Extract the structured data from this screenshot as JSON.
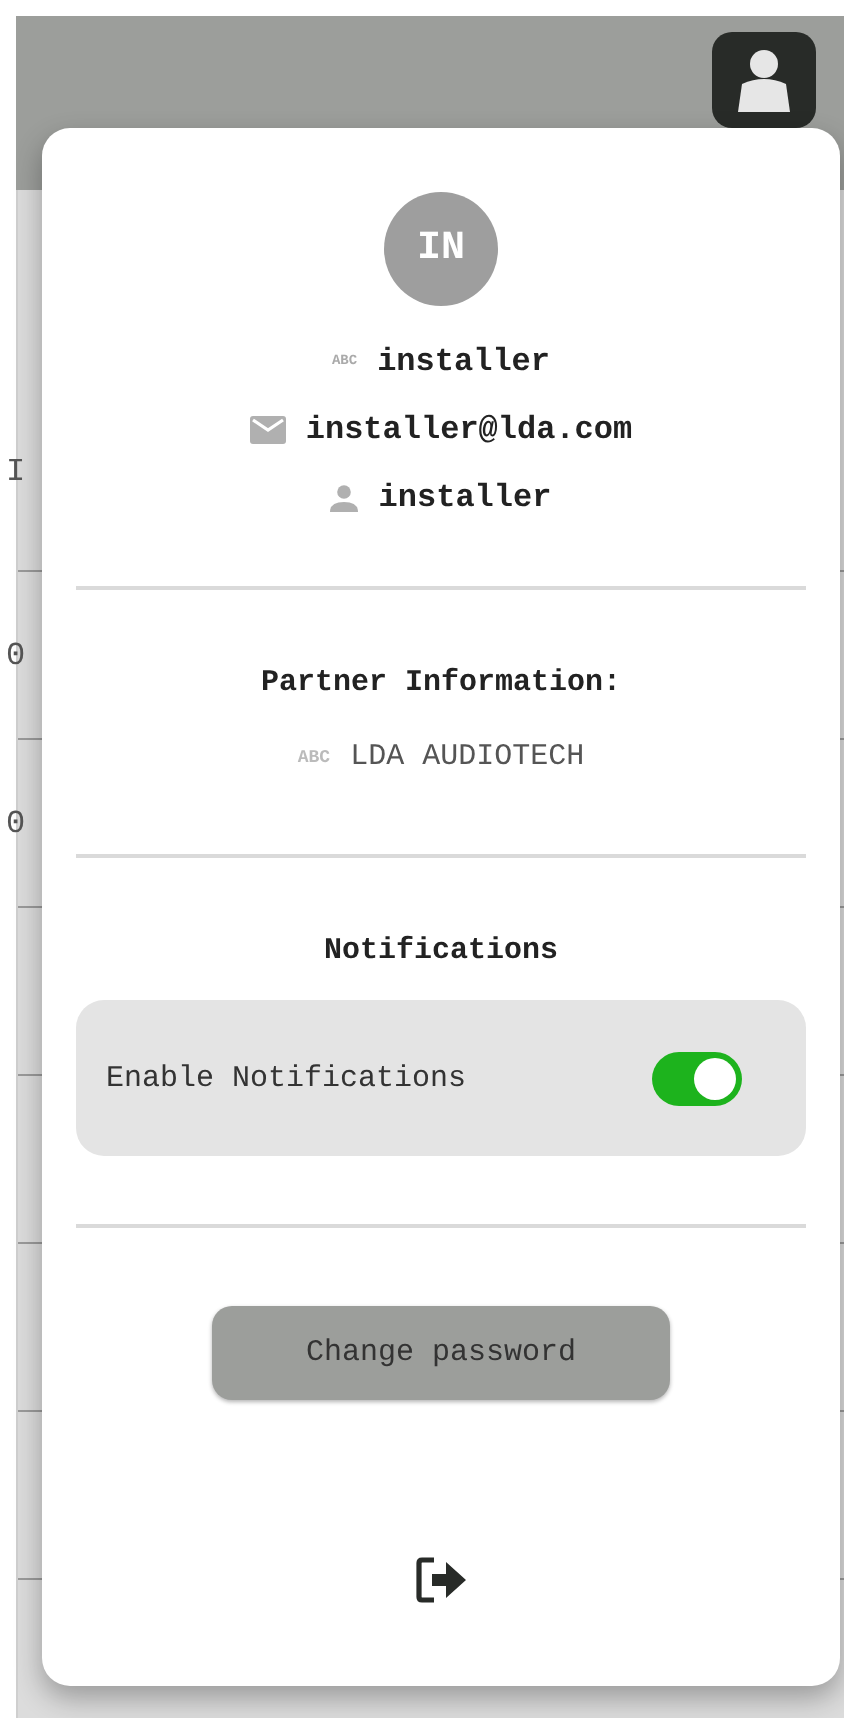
{
  "backdrop": {
    "heading": "I",
    "cells": [
      {
        "text": "0"
      },
      {
        "text": "0"
      }
    ]
  },
  "profile": {
    "initials": "IN",
    "fields": [
      {
        "kind": "name",
        "badge": "ABC",
        "text": "installer"
      },
      {
        "kind": "email",
        "text": "installer@lda.com"
      },
      {
        "kind": "username",
        "text": "installer"
      }
    ]
  },
  "partner": {
    "title": "Partner Information:",
    "badge": "ABC",
    "name": "LDA AUDIOTECH"
  },
  "notifications": {
    "title": "Notifications",
    "settings": [
      {
        "label": "Enable Notifications",
        "on": true
      }
    ]
  },
  "change_password": "Change password"
}
